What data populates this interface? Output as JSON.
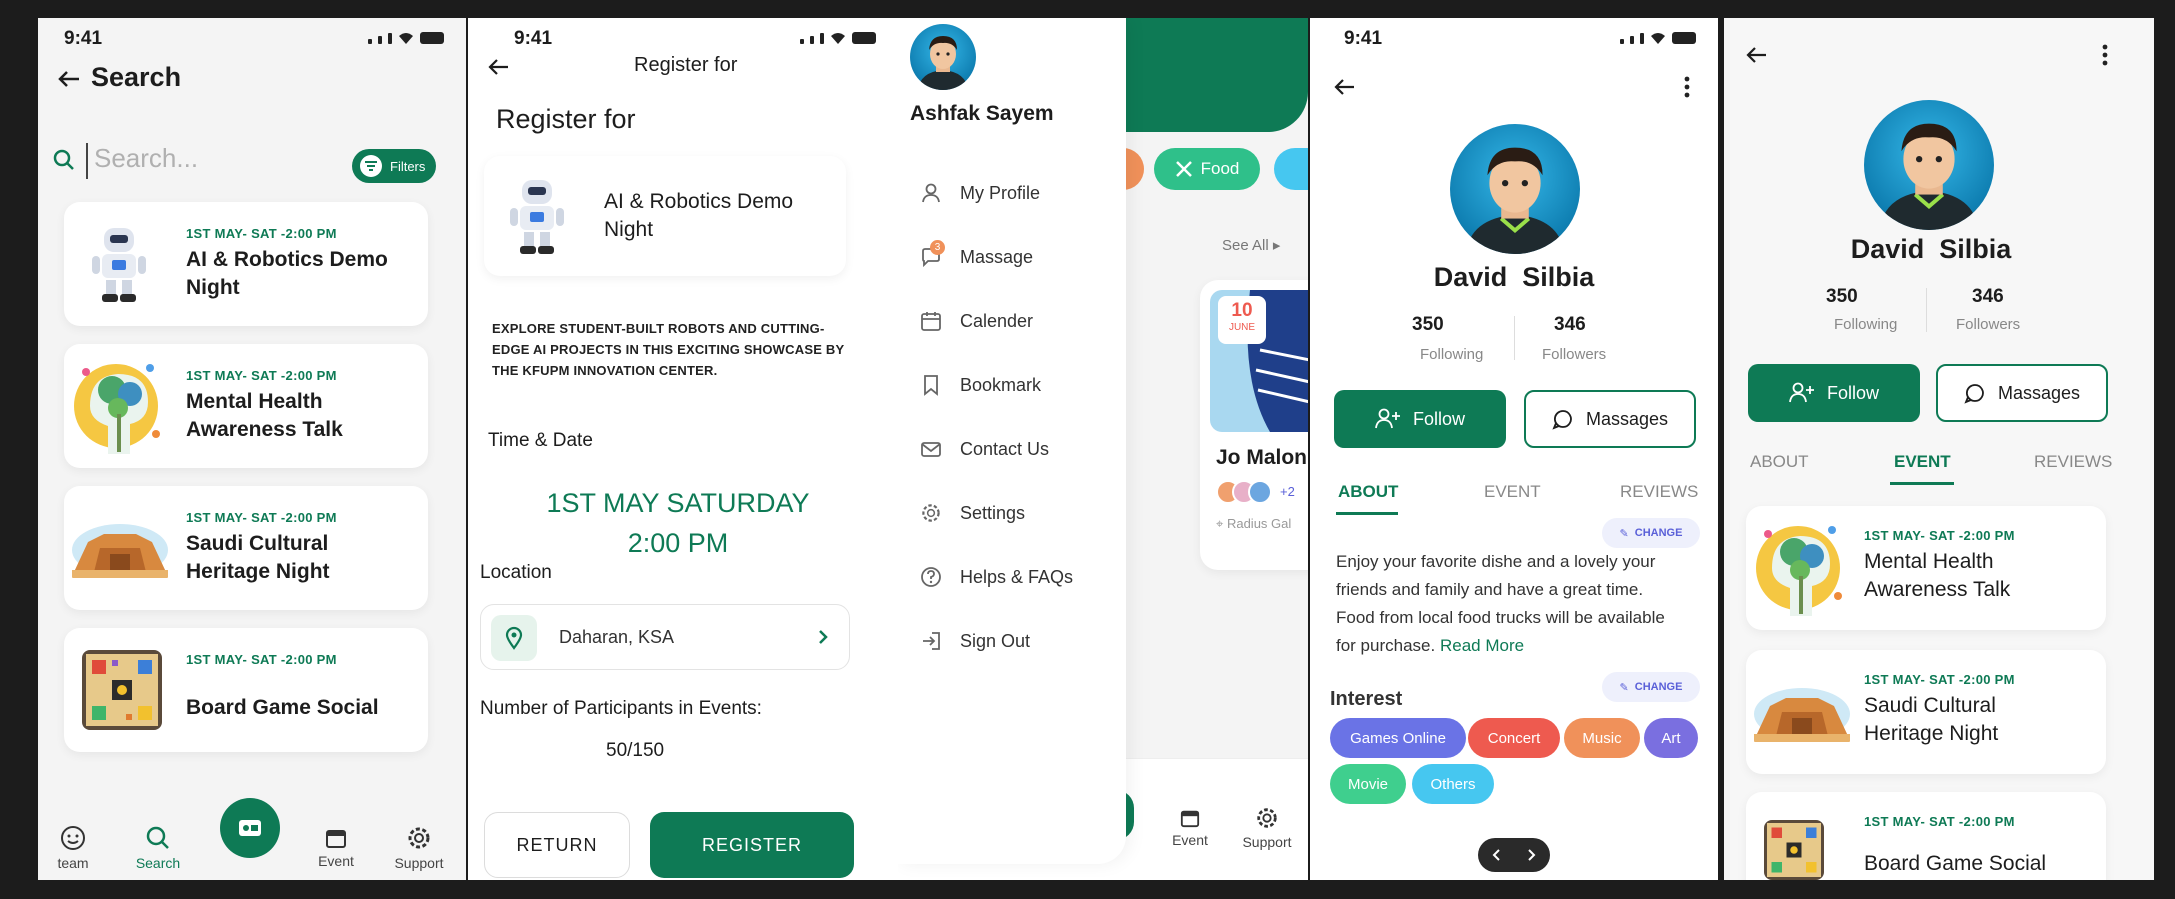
{
  "status_time": "9:41",
  "events": [
    {
      "date": "1ST MAY- SAT -2:00 PM",
      "title_l1": "AI & Robotics Demo",
      "title_l2": "Night"
    },
    {
      "date": "1ST MAY- SAT -2:00 PM",
      "title_l1": "Mental Health",
      "title_l2": "Awareness Talk"
    },
    {
      "date": "1ST MAY- SAT -2:00 PM",
      "title_l1": "Saudi Cultural",
      "title_l2": "Heritage Night"
    },
    {
      "date": "1ST MAY- SAT -2:00 PM",
      "title_l1": "Board Game Social",
      "title_l2": ""
    }
  ],
  "search_screen": {
    "title": "Search",
    "search_placeholder": "Search...",
    "filters_label": "Filters",
    "nav": {
      "team": "team",
      "search": "Search",
      "event": "Event",
      "support": "Support"
    }
  },
  "register_screen": {
    "header_title": "Register for",
    "page_title": "Register for",
    "event_title_l1": "AI & Robotics Demo",
    "event_title_l2": "Night",
    "description_l1": "EXPLORE STUDENT-BUILT ROBOTS AND CUTTING-",
    "description_l2": "EDGE AI PROJECTS IN THIS EXCITING SHOWCASE BY",
    "description_l3": "THE KFUPM INNOVATION CENTER.",
    "time_date_label": "Time & Date",
    "date_line": "1ST  MAY SATURDAY",
    "time_line": "2:00 PM",
    "location_label": "Location",
    "location_value": "Daharan, KSA",
    "participants_label": "Number of Participants in Events:",
    "participants_value": "50/150",
    "return_label": "RETURN",
    "register_label": "REGISTER"
  },
  "drawer_screen": {
    "user_name": "Ashfak Sayem",
    "menu": [
      "My Profile",
      "Massage",
      "Calender",
      "Bookmark",
      "Contact Us",
      "Settings",
      "Helps & FAQs",
      "Sign Out"
    ],
    "message_badge": "3",
    "food_chip": "Food",
    "see_all": "See All",
    "card_day": "10",
    "card_month": "JUNE",
    "card_title": "Jo Malon",
    "card_more": "+2",
    "card_location": "Radius Gal",
    "nav_event": "Event",
    "nav_support": "Support"
  },
  "profile_screen": {
    "name": "David  Silbia",
    "following_count": "350",
    "following_label": "Following",
    "followers_count": "346",
    "followers_label": "Followers",
    "follow_label": "Follow",
    "messages_label": "Massages",
    "tabs": [
      "ABOUT",
      "EVENT",
      "REVIEWS"
    ],
    "change_label": "CHANGE",
    "about_l1": "Enjoy your favorite dishe and a lovely your",
    "about_l2": "friends and family and have a great time.",
    "about_l3": "Food from local food trucks will be available",
    "about_l4": "for purchase.",
    "read_more": "Read More",
    "interest_title": "Interest",
    "interests": [
      "Games Online",
      "Concert",
      "Music",
      "Art",
      "Movie",
      "Others"
    ]
  },
  "colors": {
    "primary": "#0e7a55",
    "games_online": "#6a73e6",
    "concert": "#ee5a4f",
    "music": "#f0915a",
    "art": "#7a6fe0",
    "movie": "#3fcf8e",
    "others": "#46c7f0"
  }
}
